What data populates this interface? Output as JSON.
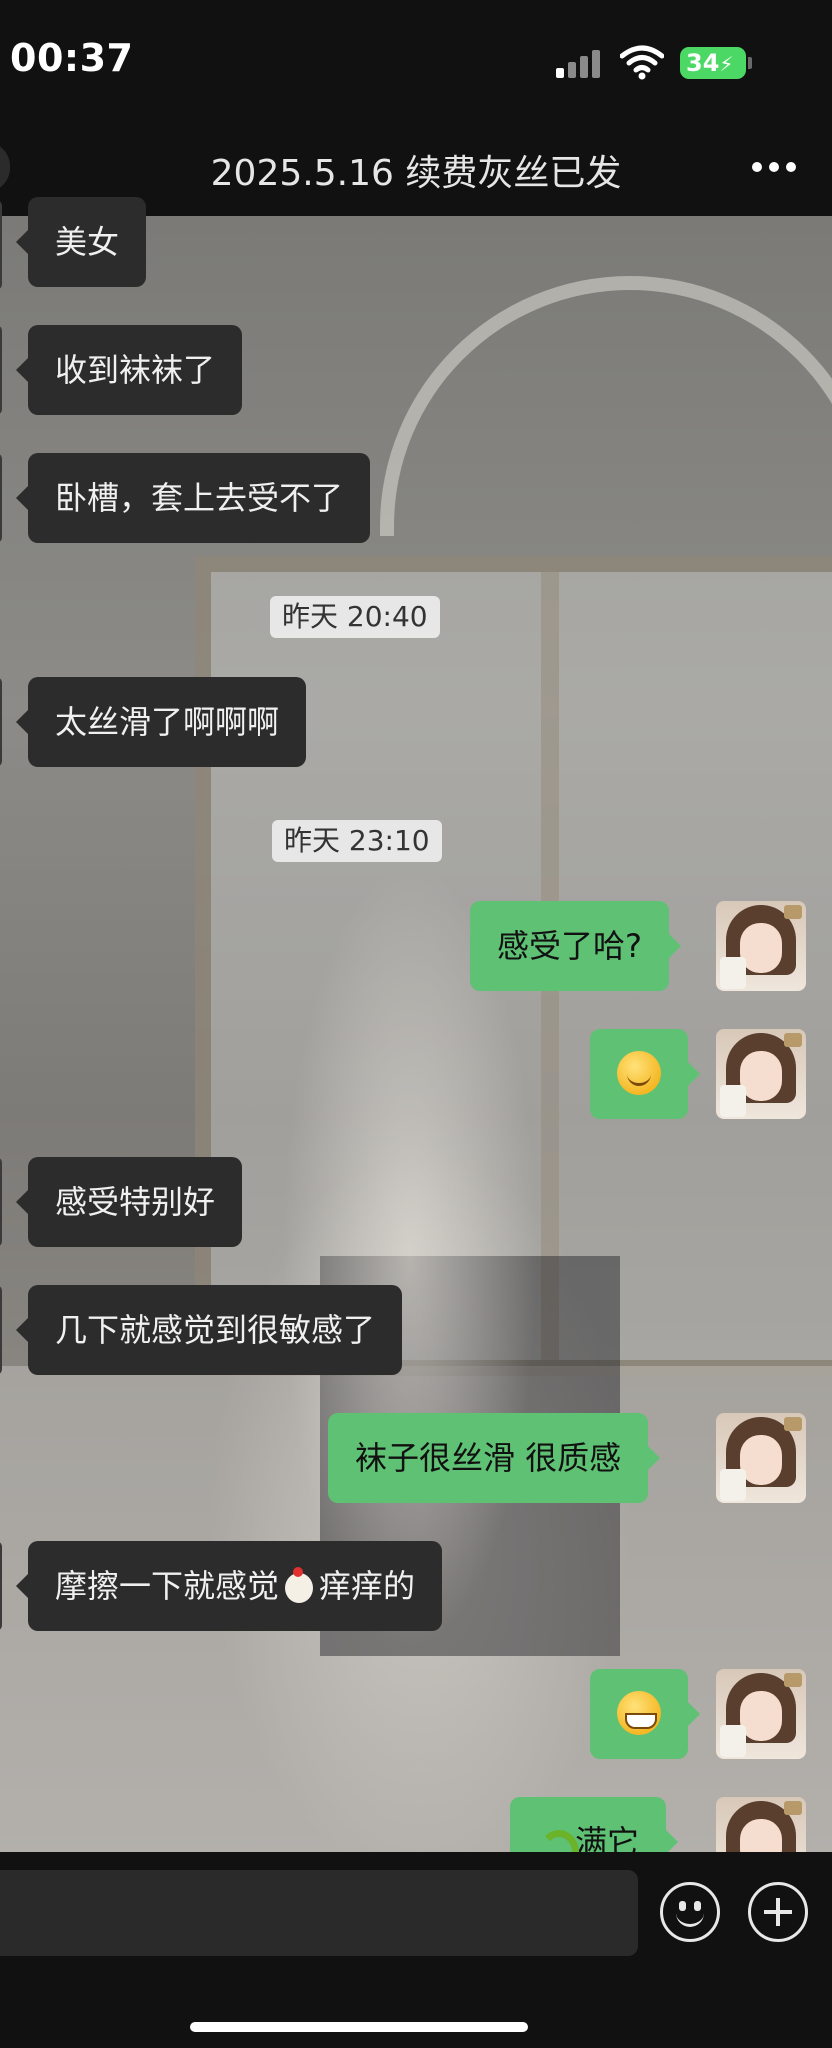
{
  "status_bar": {
    "time": "00:37",
    "battery": "34",
    "icons": [
      "cellular-signal-icon",
      "wifi-icon",
      "battery-charging-icon"
    ]
  },
  "header": {
    "title": "2025.5.16 续费灰丝已发",
    "more_icon": "more-dots-icon"
  },
  "messages": [
    {
      "side": "in",
      "text": "美女"
    },
    {
      "side": "in",
      "text": "收到袜袜了"
    },
    {
      "side": "in",
      "text": "卧槽，套上去受不了"
    },
    {
      "timestamp": "昨天 20:40"
    },
    {
      "side": "in",
      "text": "太丝滑了啊啊啊"
    },
    {
      "timestamp": "昨天 23:10"
    },
    {
      "side": "out",
      "text": "感受了哈?"
    },
    {
      "side": "out",
      "emoji": "smiling-face-emoji"
    },
    {
      "side": "in",
      "text": "感受特别好"
    },
    {
      "side": "in",
      "text": "几下就感觉到很敏感了"
    },
    {
      "side": "out",
      "text": "袜子很丝滑 很质感"
    },
    {
      "side": "in",
      "text_before": "摩擦一下就感觉",
      "emoji": "chicken-emoji",
      "text_after": "痒痒的"
    },
    {
      "side": "out",
      "emoji": "grinning-face-emoji"
    },
    {
      "side": "out",
      "emoji": "snake-emoji",
      "text": "满它"
    }
  ],
  "input_bar": {
    "emoji_icon": "emoji-face-icon",
    "plus_icon": "plus-circle-icon"
  },
  "colors": {
    "incoming_bubble": "#2c2c2c",
    "outgoing_bubble": "#5fc174",
    "bar_background": "#111111"
  }
}
